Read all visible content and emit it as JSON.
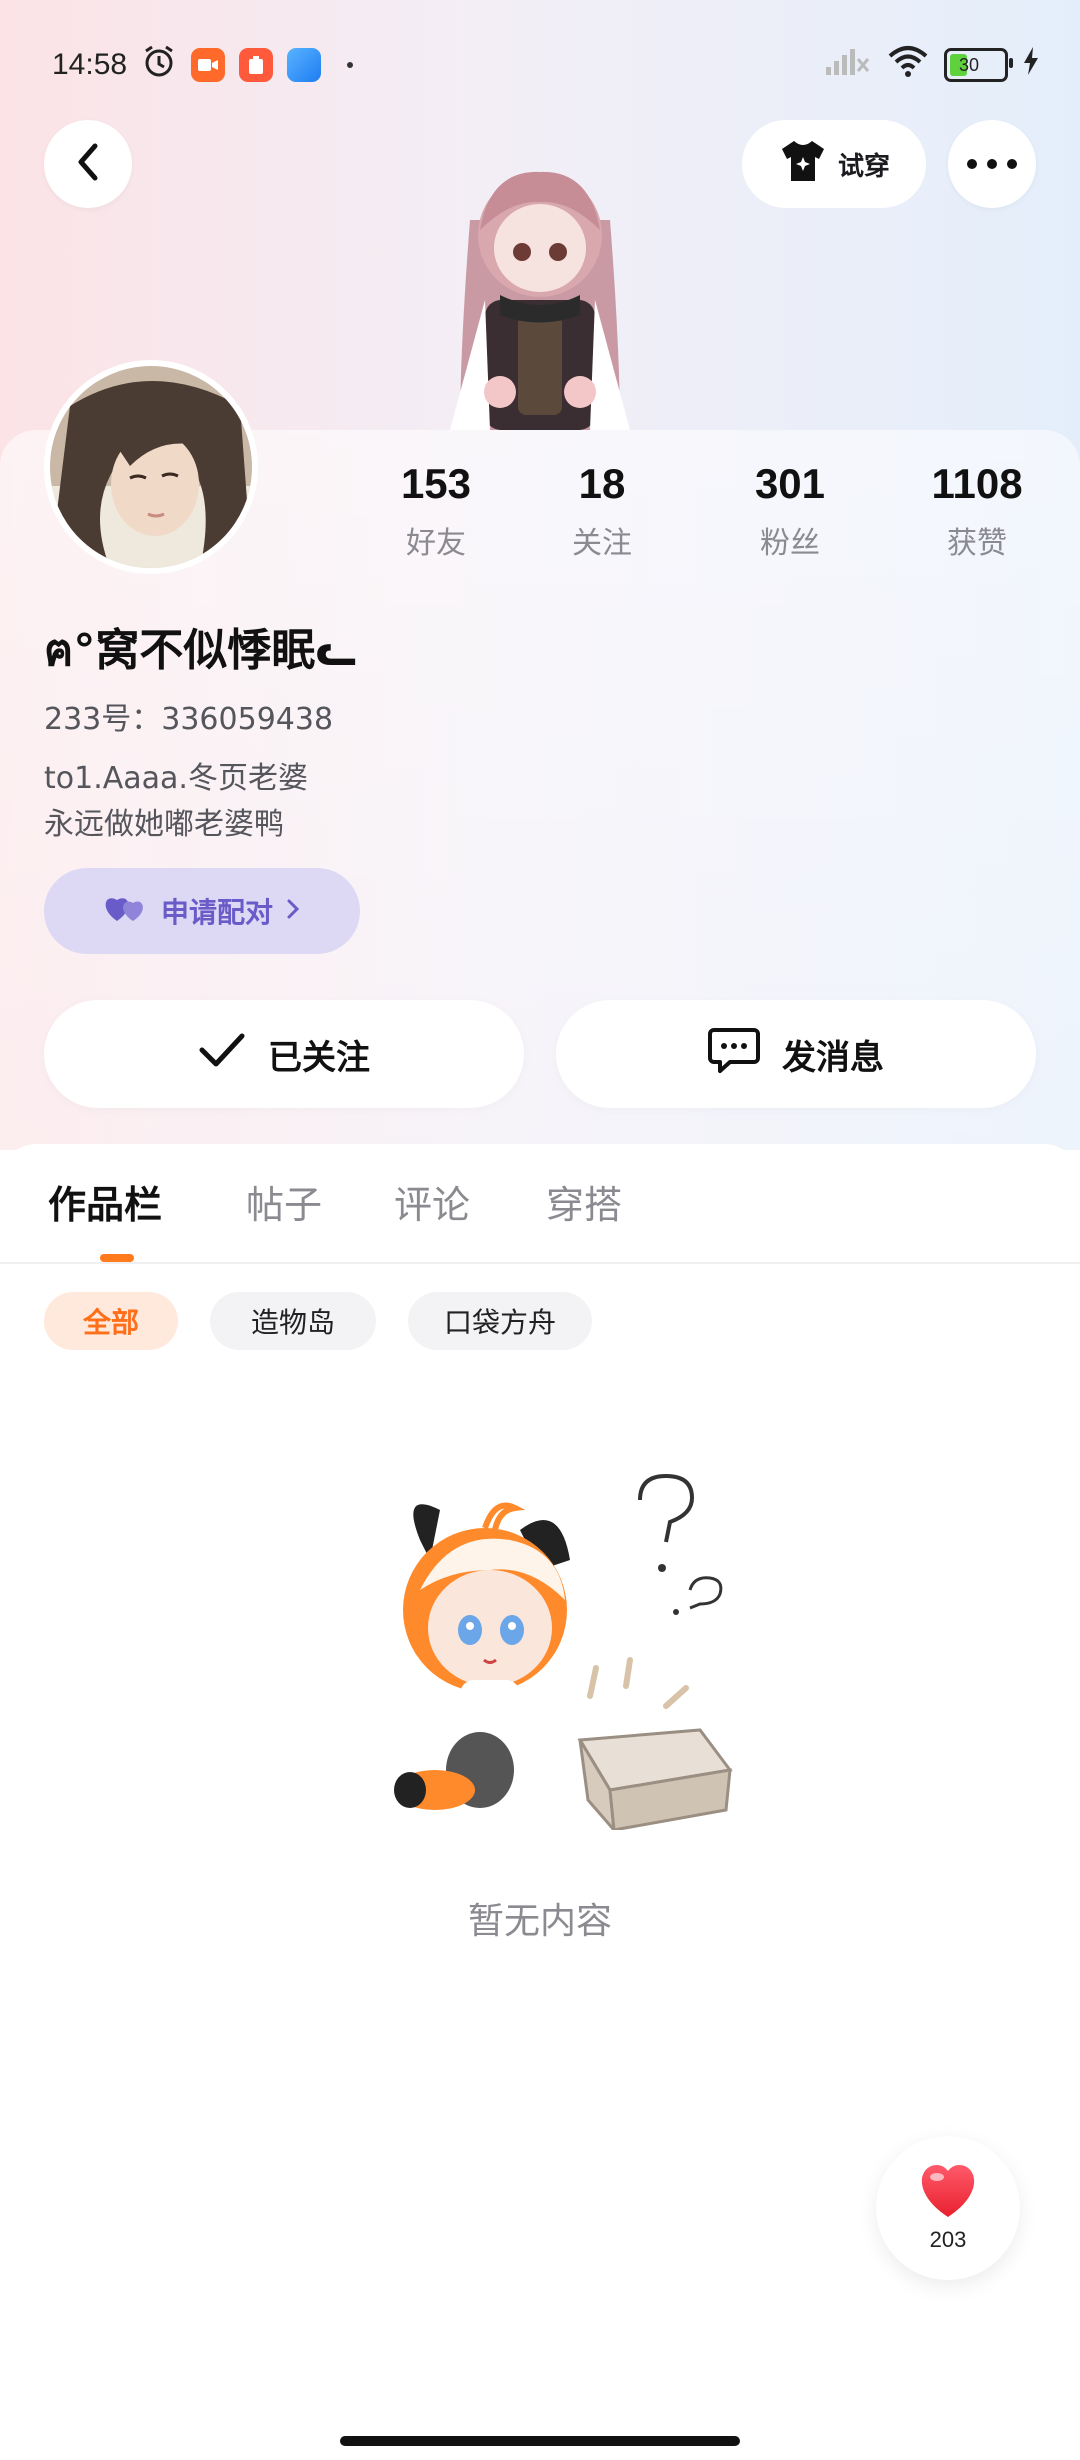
{
  "status_bar": {
    "time": "14:58",
    "battery": "30",
    "icons": [
      "alarm-icon",
      "video-app-icon",
      "orange-app-icon",
      "blue-app-icon",
      "dot-icon",
      "signal-icon",
      "wifi-icon",
      "battery-icon",
      "charging-icon"
    ]
  },
  "nav": {
    "back_icon": "chevron-left-icon",
    "try_on_label": "试穿",
    "more_icon": "more-dots-icon"
  },
  "profile": {
    "stats": [
      {
        "value": "153",
        "label": "好友"
      },
      {
        "value": "18",
        "label": "关注"
      },
      {
        "value": "301",
        "label": "粉丝"
      },
      {
        "value": "1108",
        "label": "获赞"
      }
    ],
    "nickname": "ฅ°窝不似悸眠ᓚ",
    "uid": "233号：336059438",
    "bio_line1": "to1.Aaaa.冬页老婆",
    "bio_line2": "永远做她嘟老婆鸭",
    "pair_button": "申请配对"
  },
  "actions": {
    "followed_label": "已关注",
    "message_label": "发消息"
  },
  "tabs": [
    {
      "label": "作品栏",
      "active": true
    },
    {
      "label": "帖子",
      "active": false
    },
    {
      "label": "评论",
      "active": false
    },
    {
      "label": "穿搭",
      "active": false
    }
  ],
  "filters": [
    {
      "label": "全部",
      "active": true
    },
    {
      "label": "造物岛",
      "active": false
    },
    {
      "label": "口袋方舟",
      "active": false
    }
  ],
  "empty_state": {
    "text": "暂无内容"
  },
  "like_fab": {
    "count": "203"
  },
  "colors": {
    "accent": "#ff7a1a",
    "pair_bg": "#ddd8f4",
    "pair_fg": "#6a5cc8",
    "heart": "#f2394a"
  }
}
